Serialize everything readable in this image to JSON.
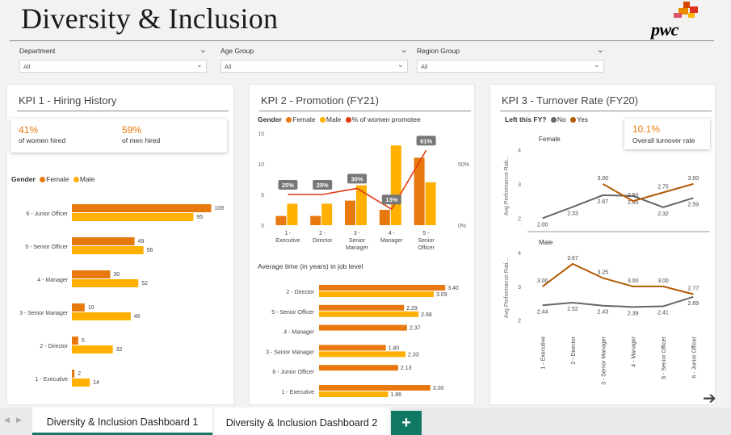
{
  "header": {
    "title": "Diversity & Inclusion",
    "logo_text": "pwc"
  },
  "filters": [
    {
      "label": "Department",
      "value": "All"
    },
    {
      "label": "Age Group",
      "value": "All"
    },
    {
      "label": "Region Group",
      "value": "All"
    }
  ],
  "kpi1": {
    "title": "KPI 1 - Hiring History",
    "cards": [
      {
        "value": "41%",
        "label": "of women hired"
      },
      {
        "value": "59%",
        "label": "of men hired"
      }
    ],
    "legend": {
      "title": "Gender",
      "items": [
        "Female",
        "Male"
      ]
    }
  },
  "kpi2": {
    "title": "KPI 2 - Promotion (FY21)",
    "legend": {
      "title": "Gender",
      "items": [
        "Female",
        "Male",
        "% of women promotee"
      ]
    },
    "sub_chart_title": "Average time (in years) in job level"
  },
  "kpi3": {
    "title": "KPI 3 - Turnover Rate (FY20)",
    "legend": {
      "title": "Left this FY?",
      "items": [
        "No",
        "Yes"
      ]
    },
    "card": {
      "value": "10.1%",
      "label": "Overall turnover rate"
    },
    "panel_labels": [
      "Female",
      "Male"
    ],
    "y_axis_title": "Avg Performance Rati..."
  },
  "colors": {
    "female": "#e8790e",
    "male": "#ffb000",
    "promotee_line": "#e03c13",
    "no": "#666666",
    "yes": "#b35a05",
    "accent": "#117865"
  },
  "tabs": {
    "items": [
      "Diversity & Inclusion Dashboard 1",
      "Diversity & Inclusion Dashboard 2"
    ],
    "active": 0,
    "add_label": "+"
  },
  "chart_data": [
    {
      "id": "hiring",
      "type": "bar",
      "orientation": "horizontal",
      "categories": [
        "6 - Junior Officer",
        "5 - Senior Officer",
        "4 - Manager",
        "3 - Senior Manager",
        "2 - Director",
        "1 - Executive"
      ],
      "series": [
        {
          "name": "Female",
          "values": [
            109,
            49,
            30,
            10,
            5,
            2
          ]
        },
        {
          "name": "Male",
          "values": [
            95,
            56,
            52,
            46,
            32,
            14
          ]
        }
      ],
      "xlim": [
        0,
        115
      ]
    },
    {
      "id": "promotion",
      "type": "bar",
      "categories": [
        "1 - Executive",
        "2 - Director",
        "3 - Senior Manager",
        "4 - Manager",
        "5 - Senior Officer"
      ],
      "series": [
        {
          "name": "Female",
          "values": [
            1.5,
            1.5,
            4,
            2.5,
            11
          ]
        },
        {
          "name": "Male",
          "values": [
            3.5,
            3.5,
            6.5,
            13,
            7
          ]
        },
        {
          "name": "% of women promotee",
          "axis": "right",
          "values": [
            25,
            25,
            30,
            13,
            61
          ]
        }
      ],
      "y_ticks": [
        0,
        5,
        10,
        15
      ],
      "ylim": [
        0,
        15
      ],
      "y2_ticks": [
        "0%",
        "50%"
      ],
      "y2lim": [
        0,
        75
      ],
      "data_labels": [
        "25%",
        "25%",
        "30%",
        "13%",
        "61%"
      ]
    },
    {
      "id": "avg_time",
      "type": "bar",
      "orientation": "horizontal",
      "title": "Average time (in years) in job level",
      "categories": [
        "2 - Director",
        "5 - Senior Officer",
        "4 - Manager",
        "3 - Senior Manager",
        "6 - Junior Officer",
        "1 - Executive"
      ],
      "series": [
        {
          "name": "Female",
          "values": [
            3.4,
            2.29,
            2.37,
            1.8,
            2.13,
            3.0
          ]
        },
        {
          "name": "Male",
          "values": [
            3.09,
            2.68,
            null,
            2.33,
            null,
            1.86
          ]
        }
      ],
      "xlim": [
        0,
        3.7
      ]
    },
    {
      "id": "turnover_female",
      "type": "line",
      "title": "Female",
      "categories": [
        "1 - Executive",
        "2 - Director",
        "3 - Senior Manager",
        "4 - Manager",
        "5 - Senior Officer",
        "6 - Junior Officer"
      ],
      "series": [
        {
          "name": "No",
          "values": [
            2.0,
            2.33,
            2.67,
            2.65,
            2.32,
            2.59
          ]
        },
        {
          "name": "Yes",
          "values": [
            null,
            null,
            3.0,
            2.5,
            2.75,
            3.0
          ]
        }
      ],
      "ylabel": "Avg Performance Rati...",
      "y_ticks": [
        2,
        3,
        4
      ],
      "ylim": [
        1.8,
        4.1
      ],
      "labels": [
        {
          "series": "No",
          "text": [
            "2.00",
            "2.33",
            "2.67",
            "2.65",
            "2.32",
            "2.59"
          ]
        },
        {
          "series": "Yes",
          "text": [
            "",
            "",
            "3.00",
            "2.50",
            "2.75",
            "3.00"
          ]
        }
      ]
    },
    {
      "id": "turnover_male",
      "type": "line",
      "title": "Male",
      "categories": [
        "1 - Executive",
        "2 - Director",
        "3 - Senior Manager",
        "4 - Manager",
        "5 - Senior Officer",
        "6 - Junior Officer"
      ],
      "series": [
        {
          "name": "No",
          "values": [
            2.44,
            2.52,
            2.43,
            2.39,
            2.41,
            2.69
          ]
        },
        {
          "name": "Yes",
          "values": [
            3.0,
            3.67,
            3.25,
            3.0,
            3.0,
            2.77
          ]
        }
      ],
      "ylabel": "Avg Performance Rati...",
      "y_ticks": [
        2,
        3,
        4
      ],
      "ylim": [
        1.8,
        4.1
      ],
      "labels": [
        {
          "series": "No",
          "text": [
            "2.44",
            "2.52",
            "2.43",
            "2.39",
            "2.41",
            "2.69"
          ]
        },
        {
          "series": "Yes",
          "text": [
            "3.00",
            "3.67",
            "3.25",
            "3.00",
            "3.00",
            "2.77"
          ]
        }
      ]
    }
  ]
}
